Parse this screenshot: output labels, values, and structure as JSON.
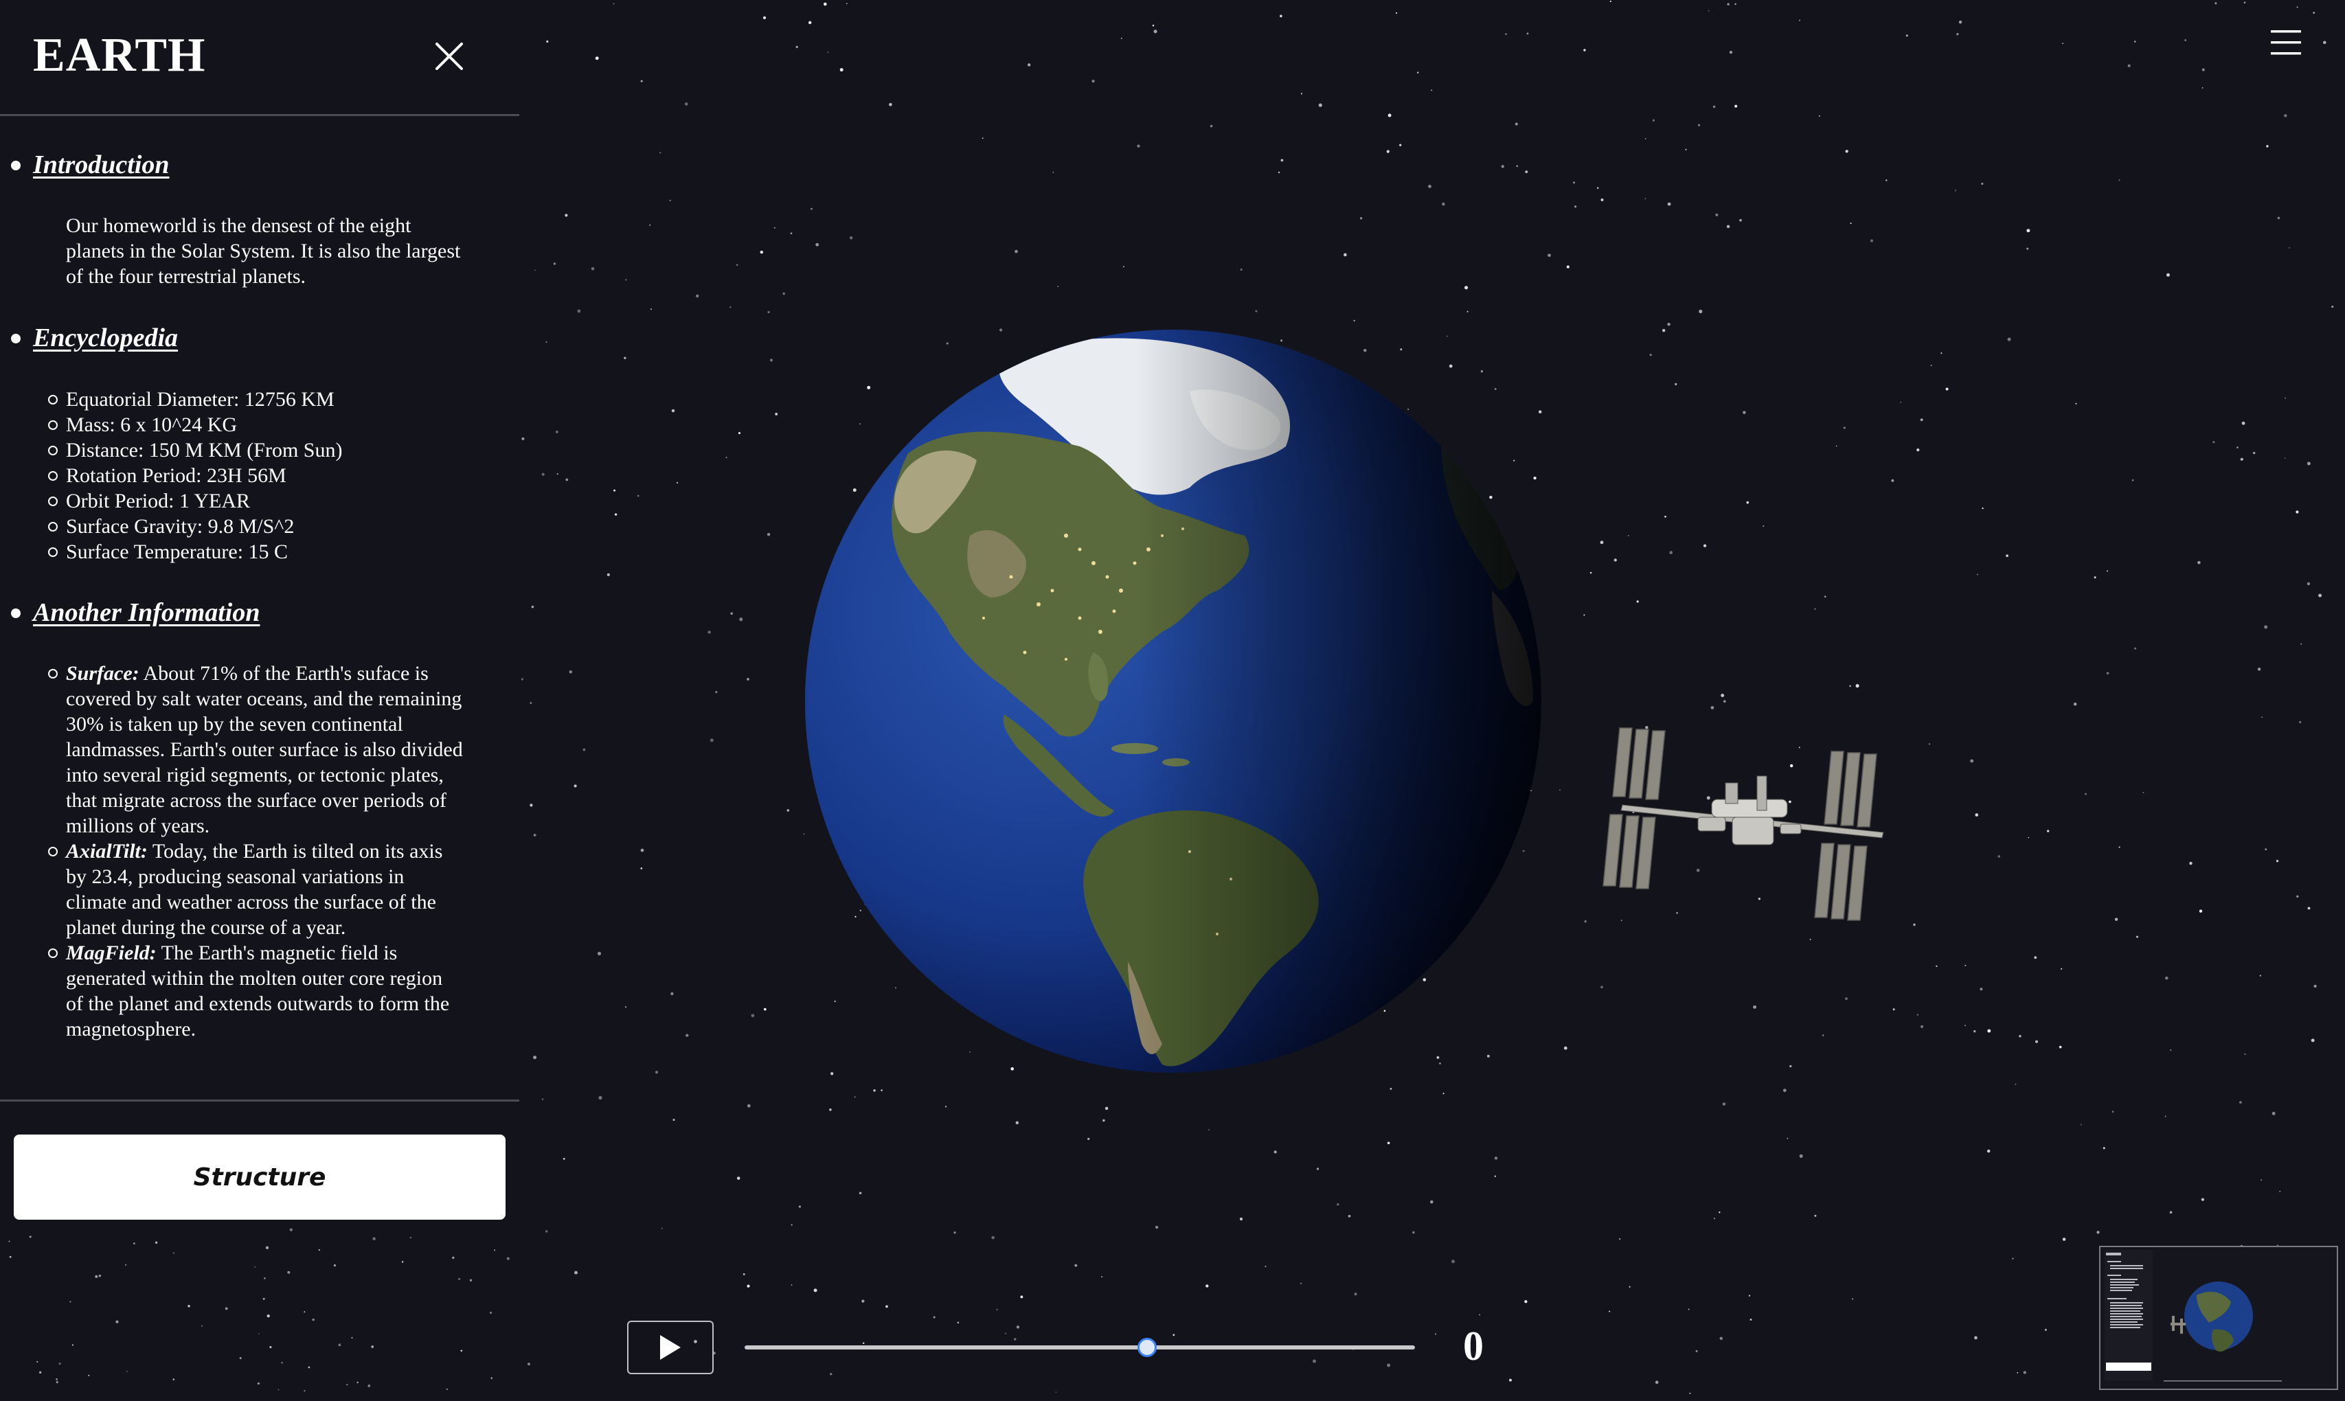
{
  "panel": {
    "title": "EARTH",
    "sections": {
      "introduction": {
        "title": "Introduction",
        "text": "Our homeworld is the densest of the eight planets in the Solar System. It is also the largest of the four terrestrial planets."
      },
      "encyclopedia": {
        "title": "Encyclopedia",
        "items": [
          "Equatorial Diameter: 12756 KM",
          "Mass: 6 x 10^24 KG",
          "Distance: 150 M KM (From Sun)",
          "Rotation Period: 23H 56M",
          "Orbit Period: 1 YEAR",
          "Surface Gravity: 9.8 M/S^2",
          "Surface Temperature: 15 C"
        ]
      },
      "another_information": {
        "title": "Another Information",
        "items": [
          {
            "term": "Surface:",
            "text": " About 71% of the Earth's suface is covered by salt water oceans, and the remaining 30% is taken up by the seven continental landmasses. Earth's outer surface is also divided into several rigid segments, or tectonic plates, that migrate across the surface over periods of millions of years."
          },
          {
            "term": "AxialTilt:",
            "text": " Today, the Earth is tilted on its axis by 23.4, producing seasonal variations in climate and weather across the surface of the planet during the course of a year."
          },
          {
            "term": "MagField:",
            "text": " The Earth's magnetic field is generated within the molten outer core region of the planet and extends outwards to form the magnetosphere."
          }
        ]
      }
    },
    "structure_button": "Structure"
  },
  "icons": {
    "close": "close-icon",
    "menu": "hamburger-menu-icon",
    "play": "play-icon"
  },
  "playback": {
    "slider_fraction": 0.6,
    "counter": "0"
  },
  "colors": {
    "background": "#13131b",
    "panel_button": "#ffffff",
    "slider_thumb_border": "#3b82f6",
    "ocean": "#1b3f8c"
  }
}
